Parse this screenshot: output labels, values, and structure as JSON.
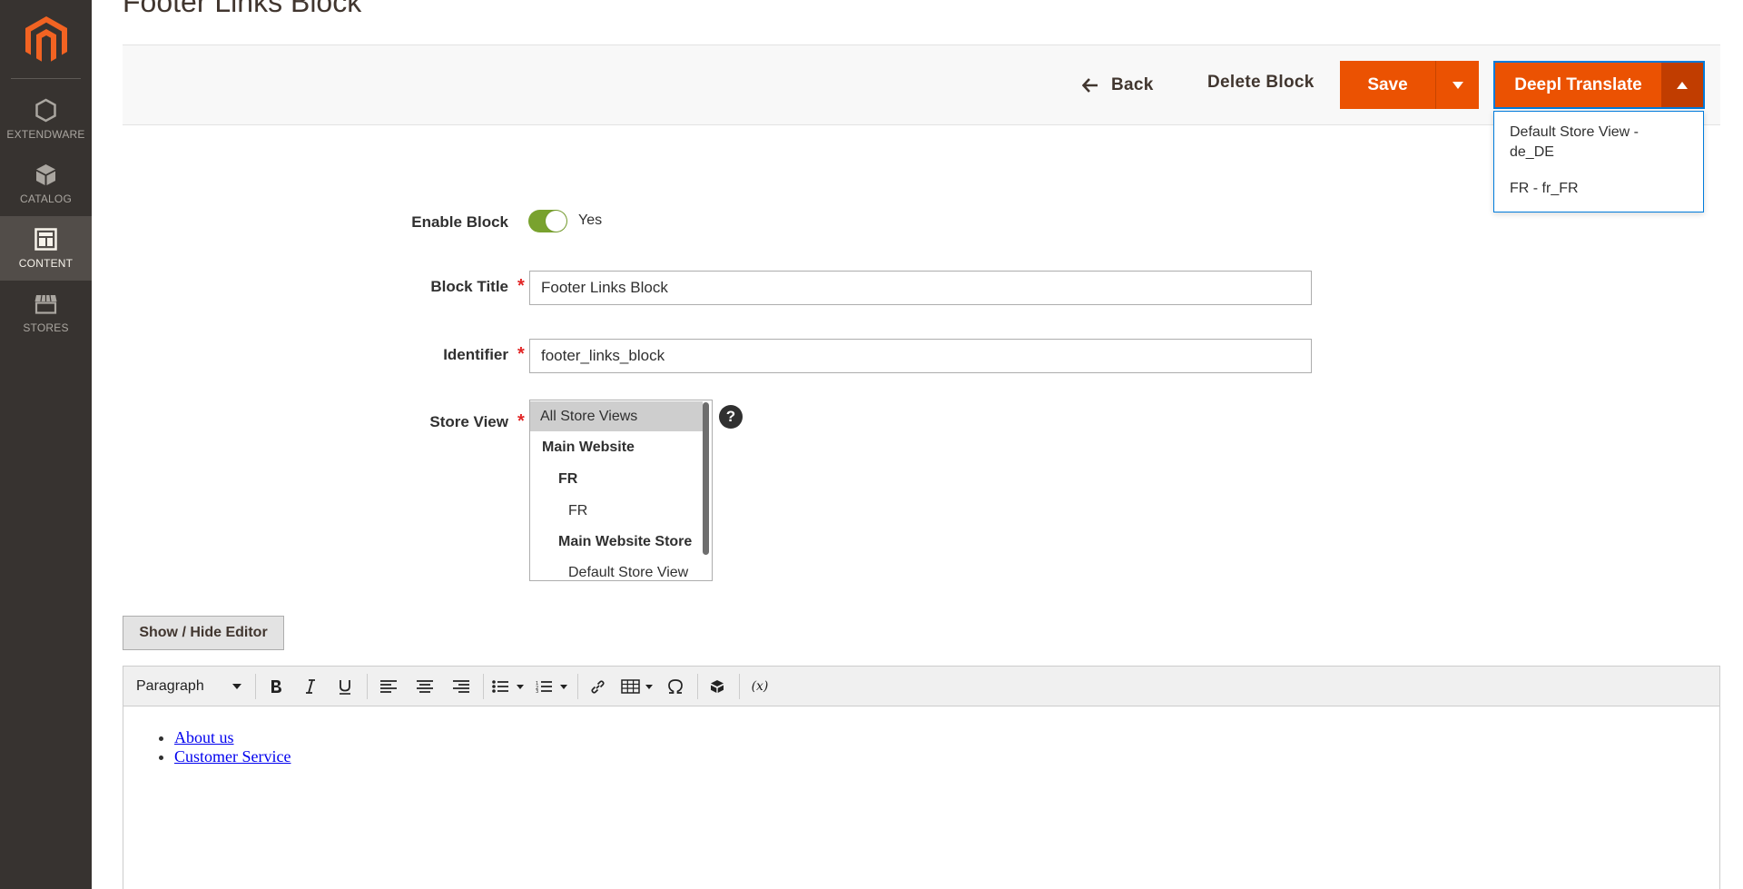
{
  "sidebar": {
    "items": [
      {
        "label": "EXTENDWARE",
        "icon": "hexagon-icon"
      },
      {
        "label": "CATALOG",
        "icon": "box-icon"
      },
      {
        "label": "CONTENT",
        "icon": "layout-icon",
        "active": true
      },
      {
        "label": "STORES",
        "icon": "storefront-icon"
      }
    ]
  },
  "page": {
    "title": "Footer Links Block"
  },
  "actions": {
    "back_label": "Back",
    "delete_label": "Delete Block",
    "save_label": "Save",
    "deepl_label": "Deepl Translate",
    "deepl_menu": [
      "Default Store View - de_DE",
      "FR - fr_FR"
    ]
  },
  "form": {
    "enable_label": "Enable Block",
    "enable_value": "Yes",
    "title_label": "Block Title",
    "title_value": "Footer Links Block",
    "identifier_label": "Identifier",
    "identifier_value": "footer_links_block",
    "store_view_label": "Store View",
    "store_options": [
      "All Store Views",
      "Main Website",
      "FR",
      "FR",
      "Main Website Store",
      "Default Store View"
    ],
    "help": "?"
  },
  "editor": {
    "toggle_label": "Show / Hide Editor",
    "format_select": "Paragraph",
    "variable_button": "(x)",
    "links": [
      "About us",
      "Customer Service"
    ]
  },
  "colors": {
    "accent": "#eb5202",
    "sidebar_bg": "#373330",
    "toggle_on": "#79a22e",
    "focus": "#007bdb"
  }
}
